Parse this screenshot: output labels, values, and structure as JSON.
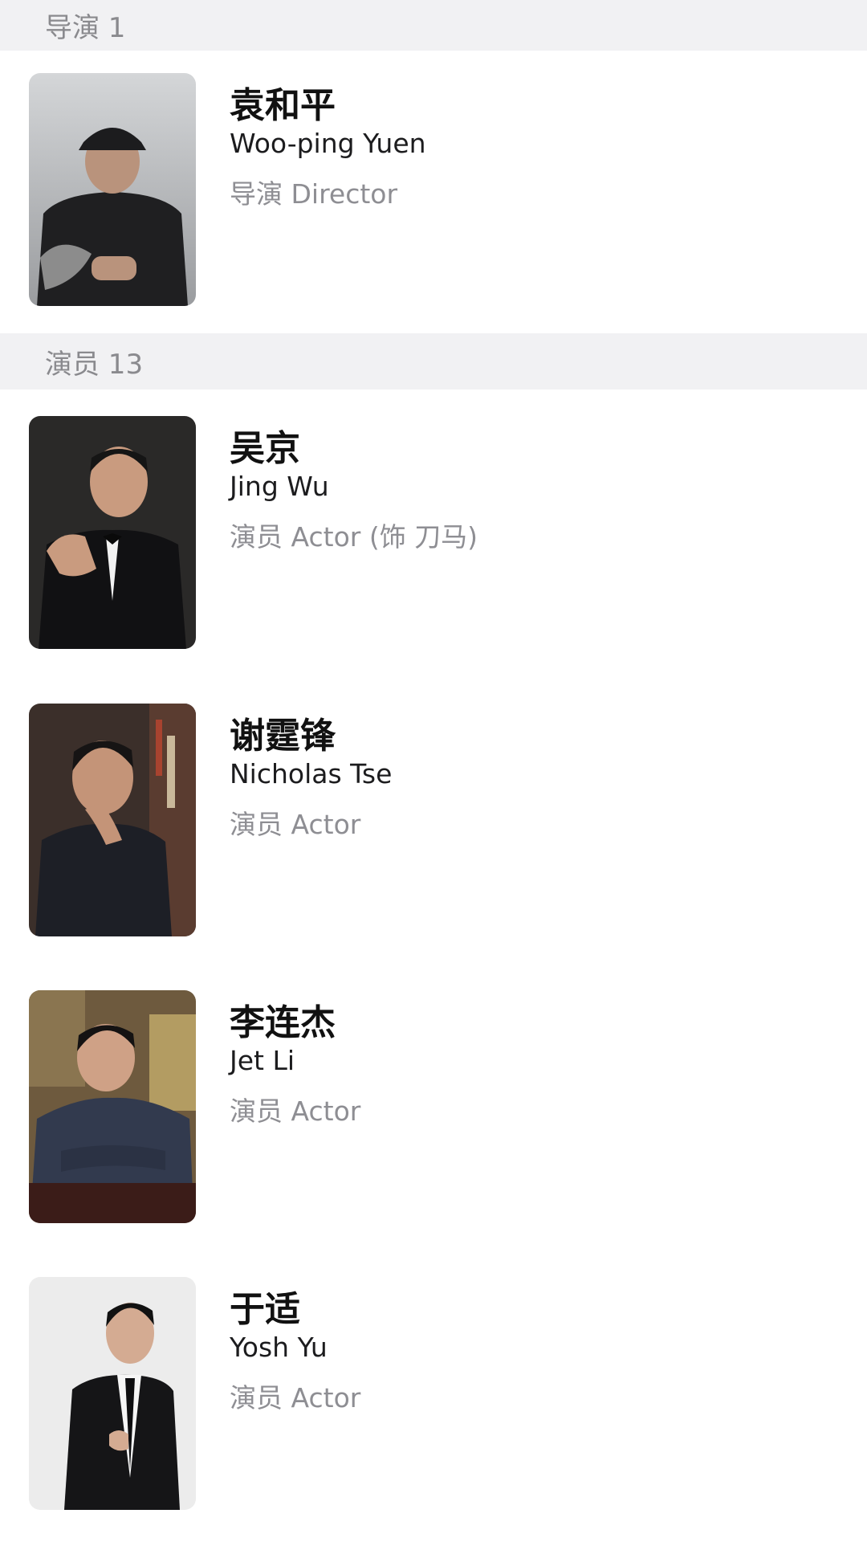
{
  "sections": [
    {
      "header": "导演 1",
      "people": [
        {
          "name_cn": "袁和平",
          "name_en": "Woo-ping Yuen",
          "role": "导演 Director"
        }
      ]
    },
    {
      "header": "演员 13",
      "people": [
        {
          "name_cn": "吴京",
          "name_en": "Jing Wu",
          "role": "演员 Actor (饰 刀马)"
        },
        {
          "name_cn": "谢霆锋",
          "name_en": "Nicholas Tse",
          "role": "演员 Actor"
        },
        {
          "name_cn": "李连杰",
          "name_en": "Jet Li",
          "role": "演员 Actor"
        },
        {
          "name_cn": "于适",
          "name_en": "Yosh Yu",
          "role": "演员 Actor"
        }
      ]
    }
  ],
  "colors": {
    "header_bg": "#f1f1f3",
    "header_text": "#8a8a8e",
    "name_text": "#111111",
    "role_text": "#8e8e93"
  }
}
